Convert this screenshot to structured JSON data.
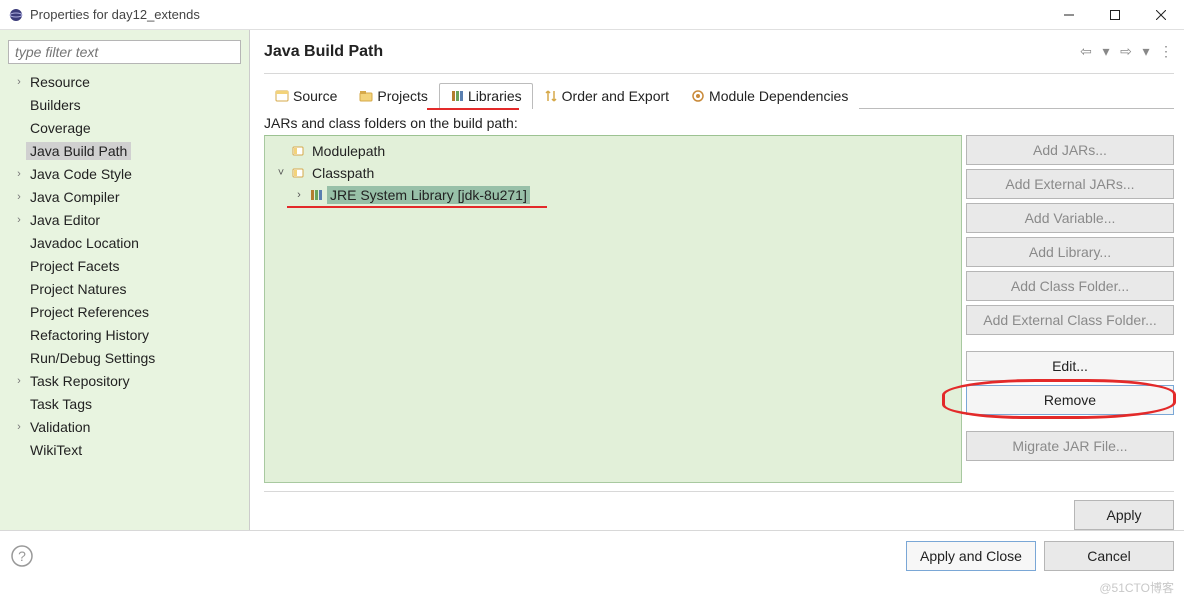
{
  "window": {
    "title": "Properties for day12_extends"
  },
  "filter": {
    "placeholder": "type filter text"
  },
  "category_tree": {
    "items": [
      {
        "label": "Resource",
        "expandable": true
      },
      {
        "label": "Builders",
        "expandable": false
      },
      {
        "label": "Coverage",
        "expandable": false
      },
      {
        "label": "Java Build Path",
        "expandable": false,
        "selected": true
      },
      {
        "label": "Java Code Style",
        "expandable": true
      },
      {
        "label": "Java Compiler",
        "expandable": true
      },
      {
        "label": "Java Editor",
        "expandable": true
      },
      {
        "label": "Javadoc Location",
        "expandable": false
      },
      {
        "label": "Project Facets",
        "expandable": false
      },
      {
        "label": "Project Natures",
        "expandable": false
      },
      {
        "label": "Project References",
        "expandable": false
      },
      {
        "label": "Refactoring History",
        "expandable": false
      },
      {
        "label": "Run/Debug Settings",
        "expandable": false
      },
      {
        "label": "Task Repository",
        "expandable": true
      },
      {
        "label": "Task Tags",
        "expandable": false
      },
      {
        "label": "Validation",
        "expandable": true
      },
      {
        "label": "WikiText",
        "expandable": false
      }
    ]
  },
  "page": {
    "title": "Java Build Path",
    "tabs": [
      {
        "key": "source",
        "label": "Source"
      },
      {
        "key": "projects",
        "label": "Projects"
      },
      {
        "key": "libraries",
        "label": "Libraries",
        "active": true
      },
      {
        "key": "order",
        "label": "Order and Export"
      },
      {
        "key": "module",
        "label": "Module Dependencies"
      }
    ],
    "description": "JARs and class folders on the build path:",
    "libtree": {
      "modulepath": "Modulepath",
      "classpath": "Classpath",
      "jre": "JRE System Library [jdk-8u271]"
    },
    "buttons": {
      "add_jars": "Add JARs...",
      "add_ext_jars": "Add External JARs...",
      "add_var": "Add Variable...",
      "add_lib": "Add Library...",
      "add_cf": "Add Class Folder...",
      "add_ext_cf": "Add External Class Folder...",
      "edit": "Edit...",
      "remove": "Remove",
      "migrate": "Migrate JAR File..."
    },
    "apply": "Apply"
  },
  "footer": {
    "apply_close": "Apply and Close",
    "cancel": "Cancel"
  },
  "watermark": "@51CTO博客"
}
